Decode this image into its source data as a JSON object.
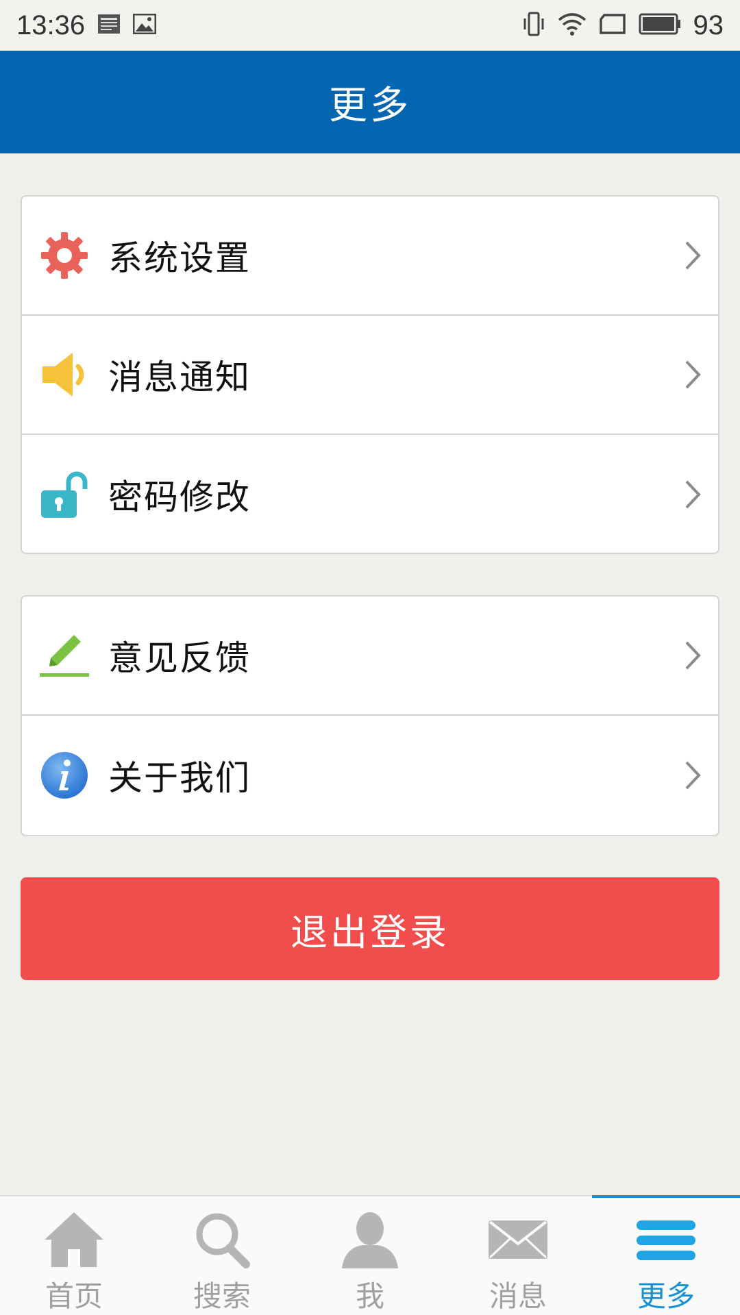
{
  "status_bar": {
    "time": "13:36",
    "battery_level": "93",
    "icons": [
      "news-icon",
      "image-icon",
      "vibrate-icon",
      "wifi-icon",
      "sim-icon",
      "battery-icon"
    ]
  },
  "header": {
    "title": "更多"
  },
  "menu_group_1": [
    {
      "label": "系统设置",
      "icon": "gear-icon",
      "icon_color": "#e8625a"
    },
    {
      "label": "消息通知",
      "icon": "speaker-icon",
      "icon_color": "#f5c23a"
    },
    {
      "label": "密码修改",
      "icon": "unlock-icon",
      "icon_color": "#3ab6c9"
    }
  ],
  "menu_group_2": [
    {
      "label": "意见反馈",
      "icon": "pencil-icon",
      "icon_color": "#7cc242"
    },
    {
      "label": "关于我们",
      "icon": "info-icon",
      "icon_color": "#3f8ee0"
    }
  ],
  "logout": {
    "label": "退出登录",
    "color": "#f24d4d"
  },
  "bottom_nav": [
    {
      "label": "首页",
      "icon": "home-icon",
      "active": false
    },
    {
      "label": "搜索",
      "icon": "search-icon",
      "active": false
    },
    {
      "label": "我",
      "icon": "user-icon",
      "active": false
    },
    {
      "label": "消息",
      "icon": "mail-icon",
      "active": false
    },
    {
      "label": "更多",
      "icon": "menu-icon",
      "active": true
    }
  ],
  "colors": {
    "primary": "#0466b0",
    "active_tab": "#1691d8",
    "inactive_tab": "#a0a0a0"
  }
}
